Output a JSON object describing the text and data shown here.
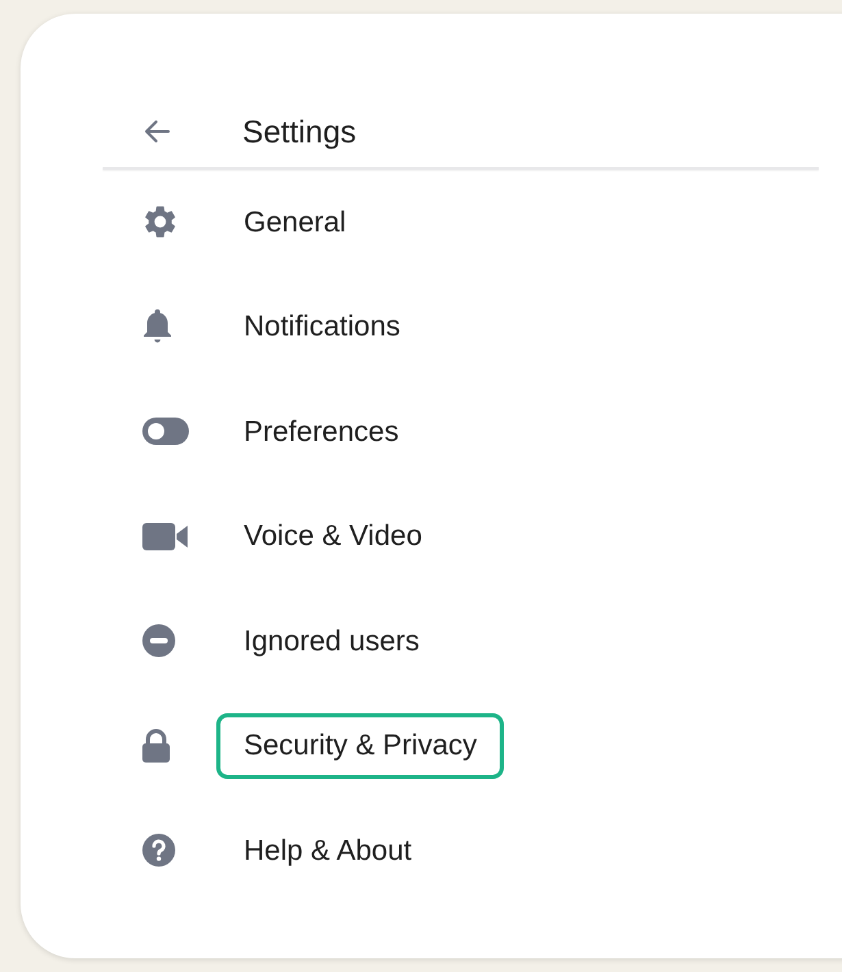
{
  "header": {
    "title": "Settings"
  },
  "items": [
    {
      "label": "General",
      "selected": false
    },
    {
      "label": "Notifications",
      "selected": false
    },
    {
      "label": "Preferences",
      "selected": false
    },
    {
      "label": "Voice & Video",
      "selected": false
    },
    {
      "label": "Ignored users",
      "selected": false
    },
    {
      "label": "Security & Privacy",
      "selected": true
    },
    {
      "label": "Help & About",
      "selected": false
    }
  ]
}
